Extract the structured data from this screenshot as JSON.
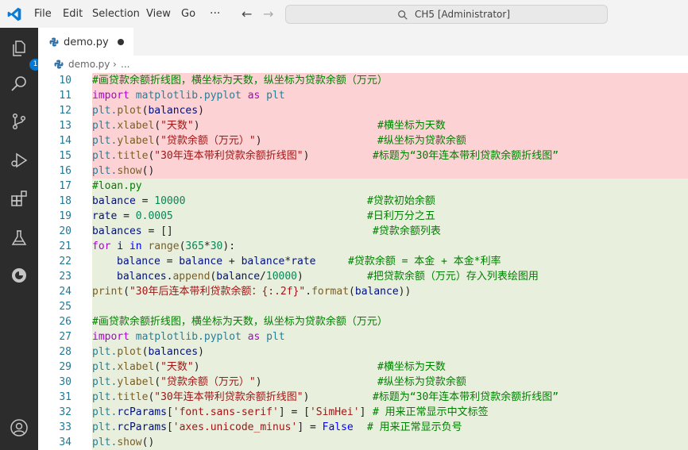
{
  "titlebar": {
    "menu": [
      "File",
      "Edit",
      "Selection",
      "View",
      "Go",
      "···"
    ],
    "command_center": "CH5 [Administrator]"
  },
  "activity_bar": {
    "explorer_badge": "1"
  },
  "tab": {
    "label": "demo.py"
  },
  "breadcrumb": {
    "file": "demo.py",
    "sep": "›",
    "more": "..."
  },
  "colors": {
    "deleted_bg": "#fdd2d4",
    "inserted_bg": "#e8efdc",
    "line_number": "#237893",
    "comment": "#008000",
    "accent": "#0078d4"
  },
  "editor": {
    "lines": [
      {
        "n": "10",
        "t": "#画贷款余额折线图，横坐标为天数，纵坐标为贷款余额（万元）"
      },
      {
        "n": "11",
        "a": "import",
        "b": " matplotlib.pyplot ",
        "c": "as",
        "d": " plt"
      },
      {
        "n": "12",
        "a": "plt.",
        "b": "plot",
        "c": "(",
        "d": "balances",
        "e": ")"
      },
      {
        "n": "13",
        "a": "plt.",
        "b": "xlabel",
        "c": "(",
        "d": "\"天数\"",
        "e": ")",
        "cm": "#横坐标为天数"
      },
      {
        "n": "14",
        "a": "plt.",
        "b": "ylabel",
        "c": "(",
        "d": "\"贷款余额（万元）\"",
        "e": ")",
        "cm": "#纵坐标为贷款余额"
      },
      {
        "n": "15",
        "a": "plt.",
        "b": "title",
        "c": "(",
        "d": "\"30年连本带利贷款余额折线图\"",
        "e": ")",
        "cm": "#标题为“30年连本带利贷款余额折线图”"
      },
      {
        "n": "16",
        "a": "plt.",
        "b": "show",
        "c": "()"
      },
      {
        "n": "17",
        "t": "#loan.py"
      },
      {
        "n": "18",
        "a": "balance",
        "b": " = ",
        "c": "10000",
        "cm": "#贷款初始余额"
      },
      {
        "n": "19",
        "a": "rate",
        "b": " = ",
        "c": "0.0005",
        "cm": "#日利万分之五"
      },
      {
        "n": "20",
        "a": "balances",
        "b": " = []",
        "cm": "#贷款余额列表"
      },
      {
        "n": "21",
        "a": "for",
        "b": " i ",
        "c": "in",
        "d": " ",
        "e": "range",
        "f": "(",
        "g": "365",
        "h": "*",
        "i": "30",
        "j": "):"
      },
      {
        "n": "22",
        "a": "balance",
        "b": " = ",
        "c": "balance",
        "d": " + ",
        "e": "balance",
        "f": "*",
        "g": "rate",
        "cm": "#贷款余额 = 本金 + 本金*利率"
      },
      {
        "n": "23",
        "a": "balances.",
        "b": "append",
        "c": "(",
        "d": "balance",
        "e": "/",
        "f": "10000",
        "g": ")",
        "cm": "#把贷款余额（万元）存入列表绘图用"
      },
      {
        "n": "24",
        "a": "print",
        "b": "(",
        "c": "\"30年后连本带利贷款余额：{:.2f}\"",
        "d": ".",
        "e": "format",
        "f": "(",
        "g": "balance",
        "h": "))"
      },
      {
        "n": "25"
      },
      {
        "n": "26",
        "t": "#画贷款余额折线图，横坐标为天数，纵坐标为贷款余额（万元）"
      },
      {
        "n": "27",
        "a": "import",
        "b": " matplotlib.pyplot ",
        "c": "as",
        "d": " plt"
      },
      {
        "n": "28",
        "a": "plt.",
        "b": "plot",
        "c": "(",
        "d": "balances",
        "e": ")"
      },
      {
        "n": "29",
        "a": "plt.",
        "b": "xlabel",
        "c": "(",
        "d": "\"天数\"",
        "e": ")",
        "cm": "#横坐标为天数"
      },
      {
        "n": "30",
        "a": "plt.",
        "b": "ylabel",
        "c": "(",
        "d": "\"贷款余额（万元）\"",
        "e": ")",
        "cm": "#纵坐标为贷款余额"
      },
      {
        "n": "31",
        "a": "plt.",
        "b": "title",
        "c": "(",
        "d": "\"30年连本带利贷款余额折线图\"",
        "e": ")",
        "cm": "#标题为“30年连本带利贷款余额折线图”"
      },
      {
        "n": "32",
        "a": "plt.",
        "b": "rcParams",
        "c": "[",
        "d": "'font.sans-serif'",
        "e": "] = [",
        "f": "'SimHei'",
        "g": "]",
        "cm": "# 用来正常显示中文标签"
      },
      {
        "n": "33",
        "a": "plt.",
        "b": "rcParams",
        "c": "[",
        "d": "'axes.unicode_minus'",
        "e": "] = ",
        "f": "False",
        "cm": "# 用来正常显示负号"
      },
      {
        "n": "34",
        "a": "plt.",
        "b": "show",
        "c": "()"
      }
    ]
  }
}
